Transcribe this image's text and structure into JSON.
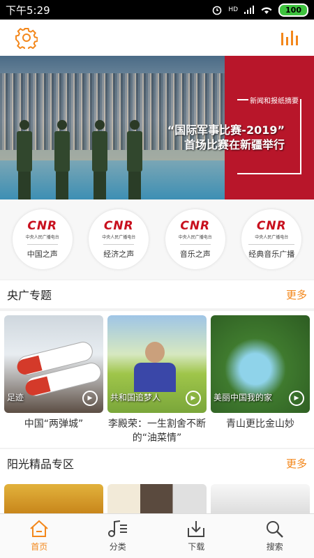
{
  "status_bar": {
    "time": "下午5:29",
    "signal": "HD",
    "battery": "100"
  },
  "banner": {
    "tag": "新闻和报纸摘要",
    "headline_line1": "“国际军事比赛-2019”",
    "headline_line2": "首场比赛在新疆举行",
    "page_count": 5,
    "active_index": 0
  },
  "stations": [
    {
      "logo": "CNR",
      "sub": "中央人民广播电台",
      "name": "中国之声"
    },
    {
      "logo": "CNR",
      "sub": "中央人民广播电台",
      "name": "经济之声"
    },
    {
      "logo": "CNR",
      "sub": "中央人民广播电台",
      "name": "音乐之声"
    },
    {
      "logo": "CNR",
      "sub": "中央人民广播电台",
      "name": "经典音乐广播"
    }
  ],
  "section1": {
    "title": "央广专题",
    "more": "更多",
    "cards": [
      {
        "caption": "足迹",
        "title": "中国“两弹城”"
      },
      {
        "caption": "共和国追梦人",
        "title": "李殿荣：一生割舍不断的“油菜情”"
      },
      {
        "caption": "美丽中国我的家",
        "title": "青山更比金山妙"
      }
    ]
  },
  "section2": {
    "title": "阳光精品专区",
    "more": "更多"
  },
  "tabbar": {
    "items": [
      {
        "label": "首页",
        "icon": "home-icon",
        "active": true
      },
      {
        "label": "分类",
        "icon": "music-list-icon",
        "active": false
      },
      {
        "label": "下载",
        "icon": "download-icon",
        "active": false
      },
      {
        "label": "搜索",
        "icon": "search-icon",
        "active": false
      }
    ]
  },
  "colors": {
    "accent": "#f3871b",
    "cnr_red": "#c8101e",
    "banner_red": "#b8162a"
  }
}
